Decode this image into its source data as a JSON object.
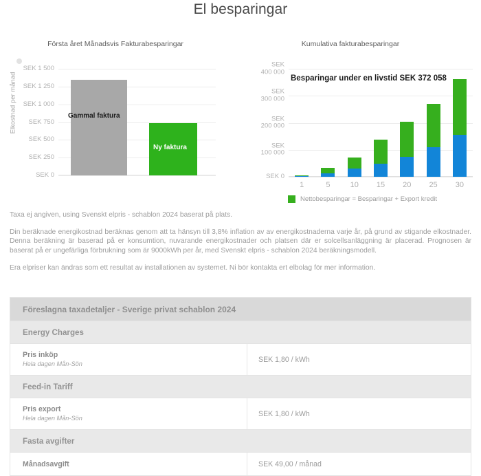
{
  "page": {
    "title": "El besparingar"
  },
  "charts": {
    "left": {
      "subtitle": "Första året Månadsvis Fakturabesparingar",
      "ylabel": "Elkostnad per månad"
    },
    "right": {
      "subtitle": "Kumulativa fakturabesparingar",
      "annotation": "Besparingar under en livstid SEK 372 058",
      "legend_label": "Nettobesparingar = Besparingar + Export kredit"
    }
  },
  "chart_data": [
    {
      "type": "bar",
      "title": "Första året Månadsvis Fakturabesparingar",
      "xlabel": "",
      "ylabel": "Elkostnad per månad",
      "categories": [
        "Gammal faktura",
        "Ny faktura"
      ],
      "values": [
        1350,
        740
      ],
      "bar_labels": [
        "Gammal faktura",
        "Ny faktura"
      ],
      "bar_colors": [
        "#a8a8a8",
        "#2eb21c"
      ],
      "ylim": [
        0,
        1500
      ],
      "ytick_values": [
        0,
        250,
        500,
        750,
        1000,
        1250,
        1500
      ],
      "ytick_labels": [
        "SEK 0",
        "SEK 250",
        "SEK 500",
        "SEK 750",
        "SEK 1 000",
        "SEK 1 250",
        "SEK 1 500"
      ],
      "grid": true,
      "legend": "none"
    },
    {
      "type": "bar",
      "stacked": true,
      "title": "Kumulativa fakturabesparingar",
      "annotation": "Besparingar under en livstid SEK 372 058",
      "xlabel": "",
      "ylabel": "",
      "categories": [
        "1",
        "5",
        "10",
        "15",
        "20",
        "25",
        "30"
      ],
      "series": [
        {
          "name": "Besparingar",
          "color": "#1285d8",
          "values": [
            2000,
            14000,
            30000,
            48000,
            74000,
            110000,
            155000
          ]
        },
        {
          "name": "Export kredit",
          "color": "#36af1e",
          "values": [
            3000,
            18000,
            42000,
            89000,
            130000,
            161000,
            208000
          ]
        }
      ],
      "totals": [
        5000,
        32000,
        72000,
        137000,
        204000,
        271000,
        363000
      ],
      "ylim": [
        0,
        400000
      ],
      "ytick_values": [
        0,
        100000,
        200000,
        300000,
        400000
      ],
      "ytick_labels": [
        "SEK 0",
        "SEK 100 000",
        "SEK 200 000",
        "SEK 300 000",
        "SEK 400 000"
      ],
      "grid": true,
      "legend": "bottom",
      "legend_entries": [
        "Nettobesparingar = Besparingar + Export kredit"
      ]
    }
  ],
  "paragraphs": [
    "Taxa ej angiven, using Svenskt elpris - schablon 2024 baserat på plats.",
    "Din beräknade energikostnad beräknas genom att ta hänsyn till 3,8% inflation av av energikostnaderna varje år, på grund av stigande elkostnader. Denna beräkning är baserad på er konsumtion, nuvarande energikostnader och platsen där er solcellsanläggning är placerad. Prognosen är baserat på er ungefärliga förbrukning som är 9000kWh per år, med Svenskt elpris - schablon 2024 beräkningsmodell.",
    "Era elpriser kan ändras som ett resultat av installationen av systemet. Ni bör kontakta ert elbolag för mer information."
  ],
  "table": {
    "title": "Föreslagna taxadetaljer - Sverige privat schablon 2024",
    "sections": [
      {
        "heading": "Energy Charges",
        "rows": [
          {
            "name": "Pris inköp",
            "sub": "Hela dagen Mån-Sön",
            "value": "SEK 1,80 / kWh"
          }
        ]
      },
      {
        "heading": "Feed-in Tariff",
        "rows": [
          {
            "name": "Pris export",
            "sub": "Hela dagen Mån-Sön",
            "value": "SEK 1,80 / kWh"
          }
        ]
      },
      {
        "heading": "Fasta avgifter",
        "rows": [
          {
            "name": "Månadsavgift",
            "sub": "",
            "value": "SEK 49,00 / månad"
          }
        ]
      }
    ]
  }
}
